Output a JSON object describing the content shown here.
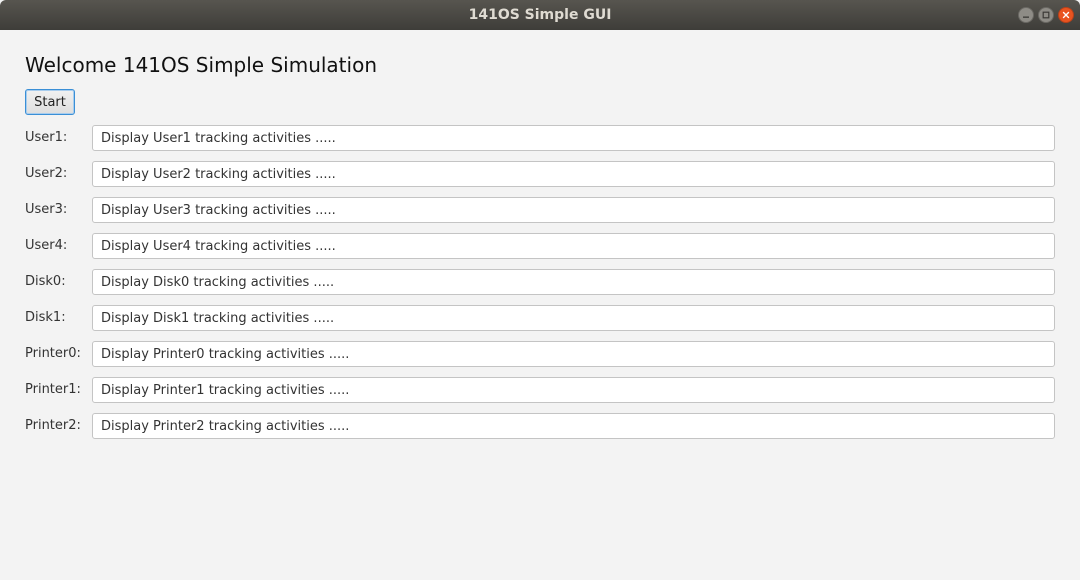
{
  "window": {
    "title": "141OS Simple GUI"
  },
  "main": {
    "heading": "Welcome 141OS Simple Simulation",
    "start_label": "Start",
    "rows": [
      {
        "label": "User1:",
        "value": "Display User1 tracking activities ....."
      },
      {
        "label": "User2:",
        "value": "Display User2 tracking activities ....."
      },
      {
        "label": "User3:",
        "value": "Display User3 tracking activities ....."
      },
      {
        "label": "User4:",
        "value": "Display User4 tracking activities ....."
      },
      {
        "label": "Disk0:",
        "value": "Display Disk0 tracking activities ....."
      },
      {
        "label": "Disk1:",
        "value": "Display Disk1 tracking activities ....."
      },
      {
        "label": "Printer0:",
        "value": "Display Printer0 tracking activities ....."
      },
      {
        "label": "Printer1:",
        "value": "Display Printer1 tracking activities ....."
      },
      {
        "label": "Printer2:",
        "value": "Display Printer2 tracking activities ....."
      }
    ]
  },
  "icons": {
    "minimize": "minimize-icon",
    "maximize": "maximize-icon",
    "close": "close-icon"
  },
  "colors": {
    "close_button": "#e95420",
    "focus_border": "#3a8fd6",
    "background": "#f3f3f3"
  }
}
